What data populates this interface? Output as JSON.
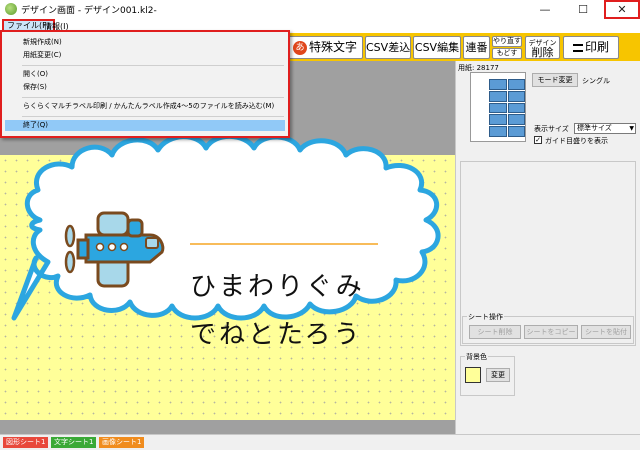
{
  "window": {
    "title": "デザイン画面 - デザイン001.kl2-",
    "minimize": "—",
    "maximize": "☐",
    "close": "✕"
  },
  "menubar": {
    "file": "ファイル(F)",
    "info": "情報(I)"
  },
  "file_menu": {
    "items": [
      "新規作成(N)",
      "用紙変更(C)",
      "開く(O)",
      "保存(S)",
      "らくらくマルチラベル印刷 / かんたんラベル作成4〜5のファイルを読み込む(M)",
      "終了(Q)"
    ],
    "highlighted_item": "終了(Q)"
  },
  "toolbar": {
    "special_icon": "あ",
    "special_chars": "特殊文字",
    "csv_insert": "CSV差込",
    "csv_edit": "CSV編集",
    "serial": "連番",
    "redo": "やり直す",
    "undo": "もどす",
    "delete_small": "デザイン",
    "delete_big": "削除",
    "print": "印刷"
  },
  "label": {
    "line1": "ひまわりぐみ",
    "line2": "でねとたろう"
  },
  "right_panel": {
    "paper_label": "用紙: 28177",
    "mode_change": "モード変更",
    "mode_value": "シングル",
    "display_size_label": "表示サイズ",
    "display_size_value": "標準サイズ",
    "guide_checkbox": "✓",
    "guide_label": "ガイド目盛りを表示",
    "sheet_ops_title": "シート操作",
    "sheet_delete": "シート削除",
    "sheet_copy": "シートをコピー",
    "sheet_paste": "シートを貼付",
    "bg_color_title": "背景色",
    "bg_change": "変更"
  },
  "tabs": [
    "図形シート1",
    "文字シート1",
    "画像シート1"
  ],
  "colors": {
    "toolbar": "#f7c500",
    "label_bg": "#ffff99",
    "cloud_outline": "#2ca6e0",
    "underline": "#f5a623",
    "highlight": "#e01e1e"
  }
}
